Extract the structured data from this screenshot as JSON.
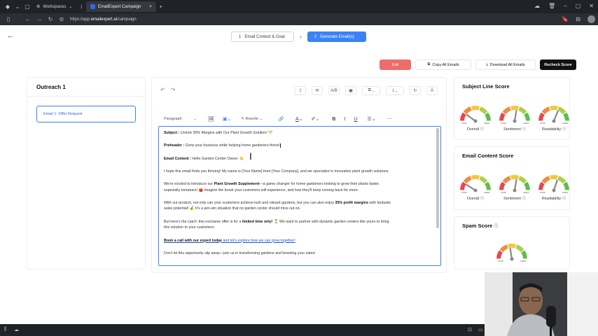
{
  "browser": {
    "workspaces_label": "Workspaces",
    "tab_title": "EmailExpert Campaign",
    "url_prefix": "https://app.",
    "url_domain": "emailexpert.ai",
    "url_path": "/campaign"
  },
  "steps": [
    {
      "number": "1",
      "label": "Email Context & Goal"
    },
    {
      "number": "2",
      "label": "Generate Email(s)"
    }
  ],
  "actions": {
    "exit": "Exit",
    "copy_all": "Copy All Emails",
    "download_all": "Download All Emails",
    "recheck": "Recheck Score"
  },
  "sidebar": {
    "title": "Outreach 1",
    "emails": [
      {
        "label": "Email 1: Offer Request"
      }
    ]
  },
  "editor": {
    "paragraph_style": "Paragraph",
    "rewrite_label": "Rewrite",
    "subject_label": "Subject :",
    "subject_text": "Unlock 35% Margins with Our Plant Growth Solution! 🌱",
    "preheader_label": "Preheader :",
    "preheader_text": "Grow your business while helping home gardeners thrive!",
    "content_label": "Email Content :",
    "content_greeting": "Hello Garden Center Owner 👋",
    "p1": "I hope this email finds you thriving! My name is [Your Name] from [Your Company], and we specialize in innovative plant growth solutions.",
    "p2_a": "We're excited to introduce our ",
    "p2_b": "Plant Growth Supplement",
    "p2_c": "—a game changer for home gardeners looking to grow their plants faster,",
    "p2_line2": "especially tomatoes! 🍅 Imagine the boost your customers will experience, and how they'll keep coming back for more.",
    "p3_a": "With our product, not only can your customers achieve lush and vibrant gardens, but you can also enjoy ",
    "p3_b": "35% profit margins",
    "p3_c": " with fantastic",
    "p3_line2": "sales potential! 💰 It's a win-win situation that no garden center should miss out on.",
    "p4_a": "But here's the catch: this exclusive offer is for a ",
    "p4_b": "limited time only!",
    "p4_c": " ⏳ We want to partner with dynamic garden centers like yours to bring",
    "p4_line2": "this solution to your customers.",
    "cta_bold": "Book a call with our expert today",
    "cta_rest": " and let's explore how we can grow together!",
    "closing": "Don't let this opportunity slip away—join us in transforming gardens and boosting your sales!"
  },
  "scores": {
    "subject": {
      "title": "Subject Line Score",
      "gauges": [
        {
          "label": "Overall",
          "level": 0.2
        },
        {
          "label": "Sentiment",
          "level": 0.55
        },
        {
          "label": "Readability",
          "level": 0.62
        }
      ]
    },
    "content": {
      "title": "Email Content Score",
      "gauges": [
        {
          "label": "Overall",
          "level": 0.18
        },
        {
          "label": "Sentiment",
          "level": 0.55
        },
        {
          "label": "Readability",
          "level": 0.6
        }
      ]
    },
    "spam": {
      "title": "Spam Score",
      "level": 0.45
    },
    "gauge_low": "POOR",
    "gauge_high": "GREAT"
  },
  "colors": {
    "primary": "#3b82f6",
    "exit": "#ee6c6c",
    "dark": "#111111"
  }
}
